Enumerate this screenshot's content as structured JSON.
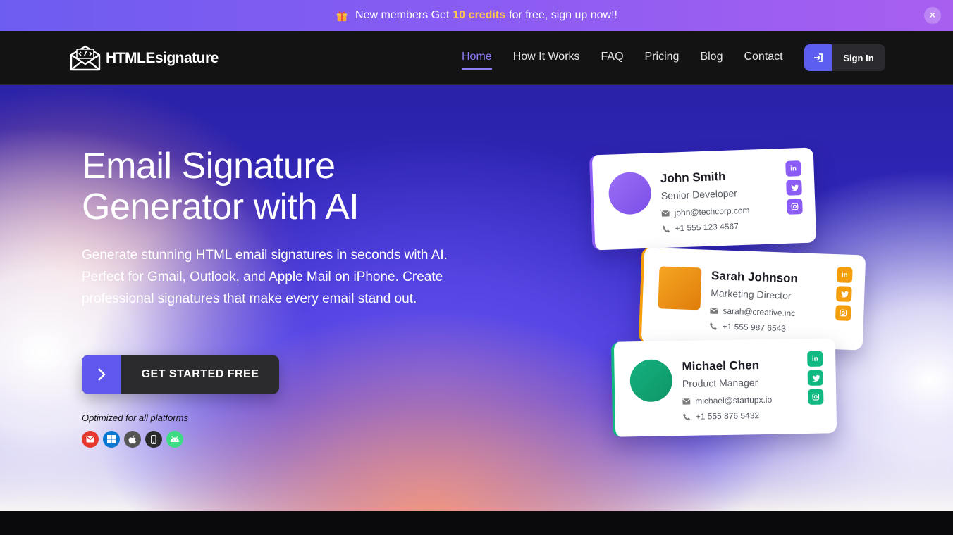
{
  "promo": {
    "text_before": "New members Get",
    "highlight": "10 credits",
    "text_after": "for free, sign up now!!",
    "close": "✕"
  },
  "brand": {
    "name_bold": "HTMLE",
    "name_rest": "signature"
  },
  "nav": {
    "items": [
      {
        "label": "Home",
        "active": true
      },
      {
        "label": "How It Works",
        "active": false
      },
      {
        "label": "FAQ",
        "active": false
      },
      {
        "label": "Pricing",
        "active": false
      },
      {
        "label": "Blog",
        "active": false
      },
      {
        "label": "Contact",
        "active": false
      }
    ],
    "signin_label": "Sign In"
  },
  "hero": {
    "title_line1": "Email Signature",
    "title_line2": "Generator with AI",
    "lede": "Generate stunning HTML email signatures in seconds with AI. Perfect for Gmail, Outlook, and Apple Mail on iPhone. Create professional signatures that make every email stand out.",
    "cta_label": "GET STARTED FREE",
    "optimized_label": "Optimized for all platforms",
    "platforms": [
      {
        "icon": "gmail-icon",
        "color": "#e5392e"
      },
      {
        "icon": "windows-icon",
        "color": "#0b78d4"
      },
      {
        "icon": "apple-icon",
        "color": "#555555"
      },
      {
        "icon": "mobile-icon",
        "color": "#2b2b2b"
      },
      {
        "icon": "android-icon",
        "color": "#3ddc84"
      }
    ]
  },
  "cards": [
    {
      "name": "John Smith",
      "role": "Senior Developer",
      "email": "john@techcorp.com",
      "phone": "+1 555 123 4567",
      "accent": "#8b5cf6"
    },
    {
      "name": "Sarah Johnson",
      "role": "Marketing Director",
      "email": "sarah@creative.inc",
      "phone": "+1 555 987 6543",
      "accent": "#f59e0b"
    },
    {
      "name": "Michael Chen",
      "role": "Product Manager",
      "email": "michael@startupx.io",
      "phone": "+1 555 876 5432",
      "accent": "#10b981"
    }
  ],
  "social_labels": {
    "linkedin": "in"
  }
}
